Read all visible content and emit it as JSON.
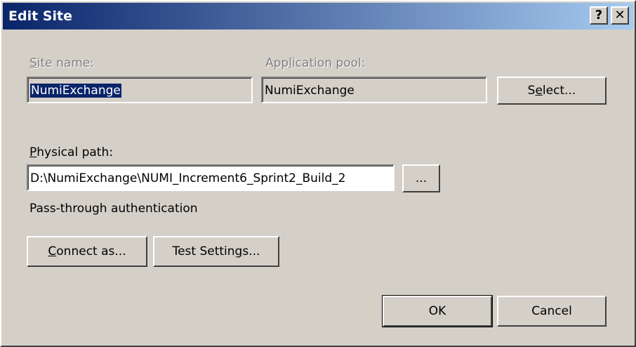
{
  "window": {
    "title": "Edit Site",
    "help_glyph": "?",
    "close_glyph": "✕"
  },
  "site_name": {
    "label_pre": "",
    "label_key": "S",
    "label_post": "ite name:",
    "value": "NumiExchange"
  },
  "app_pool": {
    "label_pre": "App",
    "label_key": "l",
    "label_post": "ication pool:",
    "value": "NumiExchange",
    "select_pre": "S",
    "select_key": "e",
    "select_post": "lect..."
  },
  "physical_path": {
    "label_pre": "",
    "label_key": "P",
    "label_post": "hysical path:",
    "value": "D:\\NumiExchange\\NUMI_Increment6_Sprint2_Build_2",
    "browse_label": "..."
  },
  "auth": {
    "text": "Pass-through authentication"
  },
  "connect_as": {
    "pre": "",
    "key": "C",
    "post": "onnect as..."
  },
  "test_settings": {
    "pre": "Test Settin",
    "key": "g",
    "post": "s..."
  },
  "dialog": {
    "ok_label": "OK",
    "cancel_label": "Cancel"
  }
}
